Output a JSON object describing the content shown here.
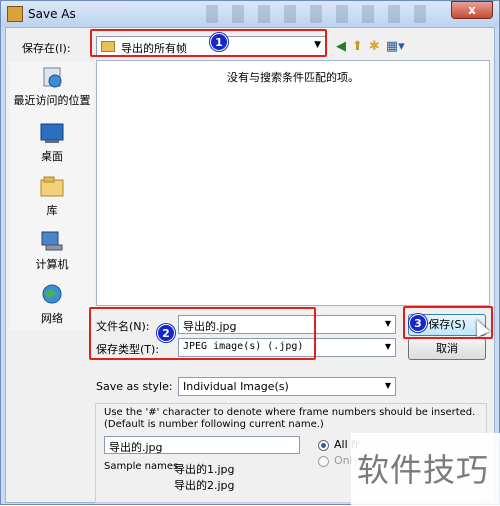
{
  "window": {
    "title": "Save As",
    "close_label": "x"
  },
  "toolbar": {
    "save_in_label": "保存在(I):",
    "save_in_value": "导出的所有帧",
    "dropdown_arrow": "▼"
  },
  "places": [
    {
      "label": "最近访问的位置",
      "icon": "recent-places-icon"
    },
    {
      "label": "桌面",
      "icon": "desktop-icon"
    },
    {
      "label": "库",
      "icon": "libraries-icon"
    },
    {
      "label": "计算机",
      "icon": "computer-icon"
    },
    {
      "label": "网络",
      "icon": "network-icon"
    }
  ],
  "filelist": {
    "empty_message": "没有与搜索条件匹配的项。"
  },
  "form": {
    "filename_label": "文件名(N):",
    "filename_value": "导出的.jpg",
    "filetype_label": "保存类型(T):",
    "filetype_value": "JPEG image(s) (.jpg)",
    "save_button": "保存(S)",
    "cancel_button": "取消"
  },
  "options": {
    "style_label": "Save as style:",
    "style_value": "Individual Image(s)",
    "hint_line1": "Use the '#' character to denote where frame numbers should be inserted.",
    "hint_line2": "(Default is number following current name.)",
    "name_value": "导出的.jpg",
    "sample_label": "Sample names:",
    "sample1": "导出的1.jpg",
    "sample2": "导出的2.jpg",
    "radio1_label": "All fr",
    "radio2_label": "Only"
  },
  "annotations": [
    "1",
    "2",
    "3"
  ],
  "watermark": "软件技巧",
  "colors": {
    "highlight": "#e0201c",
    "badge": "#1428c8"
  }
}
